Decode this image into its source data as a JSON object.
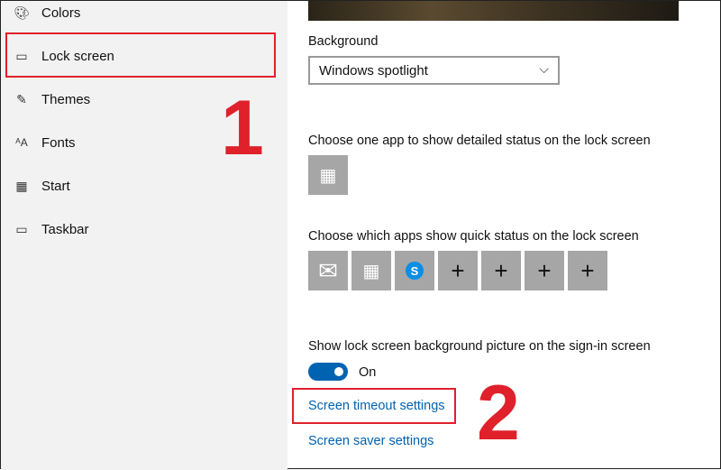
{
  "sidebar": {
    "items": [
      {
        "label": "Colors",
        "icon": "palette-icon"
      },
      {
        "label": "Lock screen",
        "icon": "lock-screen-icon"
      },
      {
        "label": "Themes",
        "icon": "themes-icon"
      },
      {
        "label": "Fonts",
        "icon": "fonts-icon"
      },
      {
        "label": "Start",
        "icon": "start-icon"
      },
      {
        "label": "Taskbar",
        "icon": "taskbar-icon"
      }
    ]
  },
  "annotations": {
    "step1": "1",
    "step2": "2",
    "highlight_color": "#e0202a"
  },
  "main": {
    "background_label": "Background",
    "background_value": "Windows spotlight",
    "detailed_status_label": "Choose one app to show detailed status on the lock screen",
    "quick_status_label": "Choose which apps show quick status on the lock screen",
    "quick_apps": [
      "mail",
      "calendar",
      "skype",
      "add",
      "add",
      "add",
      "add"
    ],
    "signin_label": "Show lock screen background picture on the sign-in screen",
    "signin_toggle": "On",
    "timeout_link": "Screen timeout settings",
    "saver_link": "Screen saver settings",
    "accent": "#0063b1"
  }
}
